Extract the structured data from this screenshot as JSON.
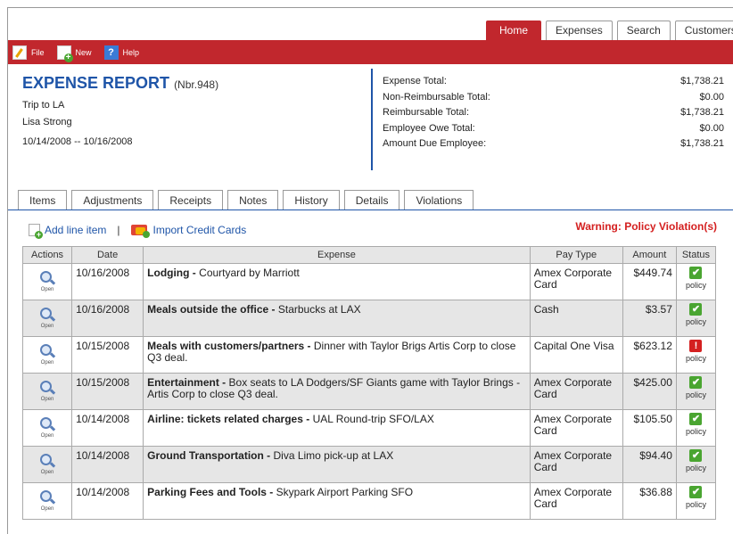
{
  "nav": {
    "tabs": [
      "Home",
      "Expenses",
      "Search",
      "Customers"
    ],
    "active": "Home"
  },
  "toolbar": {
    "file_label": "File",
    "new_label": "New",
    "help_label": "Help"
  },
  "report": {
    "title": "EXPENSE REPORT",
    "number": "(Nbr.948)",
    "trip": "Trip to LA",
    "employee": "Lisa Strong",
    "dates": "10/14/2008 -- 10/16/2008"
  },
  "totals": [
    {
      "label": "Expense Total:",
      "value": "$1,738.21"
    },
    {
      "label": "Non-Reimbursable Total:",
      "value": "$0.00"
    },
    {
      "label": "Reimbursable Total:",
      "value": "$1,738.21"
    },
    {
      "label": "Employee Owe Total:",
      "value": "$0.00"
    },
    {
      "label": "Amount Due Employee:",
      "value": "$1,738.21"
    }
  ],
  "subtabs": [
    "Items",
    "Adjustments",
    "Receipts",
    "Notes",
    "History",
    "Details",
    "Violations"
  ],
  "actions": {
    "add_line": "Add line item",
    "separator": "|",
    "import": "Import Credit Cards",
    "warning": "Warning: Policy Violation(s)"
  },
  "table": {
    "headers": [
      "Actions",
      "Date",
      "Expense",
      "Pay Type",
      "Amount",
      "Status"
    ],
    "open_label": "Open",
    "status_label": "policy",
    "rows": [
      {
        "date": "10/16/2008",
        "category": "Lodging -",
        "desc": "Courtyard by Marriott",
        "pay": "Amex Corporate Card",
        "amount": "$449.74",
        "status": "ok"
      },
      {
        "date": "10/16/2008",
        "category": "Meals outside the office -",
        "desc": "Starbucks at LAX",
        "pay": "Cash",
        "amount": "$3.57",
        "status": "ok"
      },
      {
        "date": "10/15/2008",
        "category": "Meals with customers/partners -",
        "desc": "Dinner with Taylor Brigs Artis Corp to close Q3 deal.",
        "pay": "Capital One Visa",
        "amount": "$623.12",
        "status": "violation"
      },
      {
        "date": "10/15/2008",
        "category": "Entertainment -",
        "desc": "Box seats to LA Dodgers/SF Giants game with Taylor Brings - Artis Corp to close Q3 deal.",
        "pay": "Amex Corporate Card",
        "amount": "$425.00",
        "status": "ok"
      },
      {
        "date": "10/14/2008",
        "category": "Airline: tickets related charges -",
        "desc": "UAL Round-trip SFO/LAX",
        "pay": "Amex Corporate Card",
        "amount": "$105.50",
        "status": "ok"
      },
      {
        "date": "10/14/2008",
        "category": "Ground Transportation -",
        "desc": "Diva Limo pick-up at LAX",
        "pay": "Amex Corporate Card",
        "amount": "$94.40",
        "status": "ok"
      },
      {
        "date": "10/14/2008",
        "category": "Parking Fees and Tools -",
        "desc": "Skypark Airport Parking SFO",
        "pay": "Amex Corporate Card",
        "amount": "$36.88",
        "status": "ok"
      }
    ]
  },
  "colors": {
    "brand_red": "#c1272d",
    "link_blue": "#1f55a8",
    "ok_green": "#4aa531",
    "warning_red": "#d42020"
  }
}
